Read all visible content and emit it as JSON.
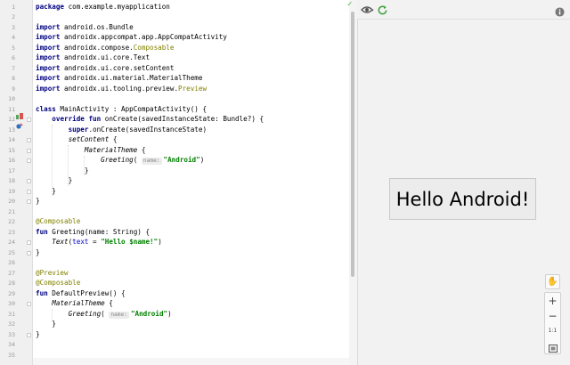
{
  "editor": {
    "lines": [
      {
        "n": "1",
        "t": [
          {
            "c": "kw",
            "v": "package"
          },
          {
            "v": " com.example.myapplication"
          }
        ]
      },
      {
        "n": "2",
        "t": []
      },
      {
        "n": "3",
        "t": [
          {
            "c": "kw",
            "v": "import"
          },
          {
            "v": " android.os.Bundle"
          }
        ]
      },
      {
        "n": "4",
        "t": [
          {
            "c": "kw",
            "v": "import"
          },
          {
            "v": " androidx.appcompat.app.AppCompatActivity"
          }
        ]
      },
      {
        "n": "5",
        "t": [
          {
            "c": "kw",
            "v": "import"
          },
          {
            "v": " androidx.compose."
          },
          {
            "c": "ann",
            "v": "Composable"
          }
        ]
      },
      {
        "n": "6",
        "t": [
          {
            "c": "kw",
            "v": "import"
          },
          {
            "v": " androidx.ui.core.Text"
          }
        ]
      },
      {
        "n": "7",
        "t": [
          {
            "c": "kw",
            "v": "import"
          },
          {
            "v": " androidx.ui.core.setContent"
          }
        ]
      },
      {
        "n": "8",
        "t": [
          {
            "c": "kw",
            "v": "import"
          },
          {
            "v": " androidx.ui.material.MaterialTheme"
          }
        ]
      },
      {
        "n": "9",
        "t": [
          {
            "c": "kw",
            "v": "import"
          },
          {
            "v": " androidx.ui.tooling.preview."
          },
          {
            "c": "ann",
            "v": "Preview"
          }
        ]
      },
      {
        "n": "10",
        "t": []
      },
      {
        "n": "11",
        "t": [
          {
            "c": "kw",
            "v": "class"
          },
          {
            "v": " MainActivity : AppCompatActivity() {"
          }
        ]
      },
      {
        "n": "12",
        "t": [
          {
            "v": "    "
          },
          {
            "c": "kw",
            "v": "override fun"
          },
          {
            "v": " onCreate(savedInstanceState: Bundle?) {"
          }
        ]
      },
      {
        "n": "13",
        "t": [
          {
            "v": "        "
          },
          {
            "c": "kw",
            "v": "super"
          },
          {
            "v": ".onCreate(savedInstanceState)"
          }
        ]
      },
      {
        "n": "14",
        "t": [
          {
            "v": "        "
          },
          {
            "c": "it",
            "v": "setContent"
          },
          {
            "v": " {"
          }
        ]
      },
      {
        "n": "15",
        "t": [
          {
            "v": "            "
          },
          {
            "c": "it",
            "v": "MaterialTheme"
          },
          {
            "v": " {"
          }
        ]
      },
      {
        "n": "16",
        "t": [
          {
            "v": "                "
          },
          {
            "c": "it",
            "v": "Greeting"
          },
          {
            "v": "( "
          },
          {
            "c": "hint",
            "v": "name:"
          },
          {
            "c": "str",
            "v": "\"Android\""
          },
          {
            "v": ")"
          }
        ]
      },
      {
        "n": "17",
        "t": [
          {
            "v": "            }"
          }
        ]
      },
      {
        "n": "18",
        "t": [
          {
            "v": "        }"
          }
        ]
      },
      {
        "n": "19",
        "t": [
          {
            "v": "    }"
          }
        ]
      },
      {
        "n": "20",
        "t": [
          {
            "v": "}"
          }
        ]
      },
      {
        "n": "21",
        "t": []
      },
      {
        "n": "22",
        "t": [
          {
            "c": "ann",
            "v": "@Composable"
          }
        ]
      },
      {
        "n": "23",
        "t": [
          {
            "c": "kw",
            "v": "fun"
          },
          {
            "v": " Greeting(name: String) {"
          }
        ]
      },
      {
        "n": "24",
        "t": [
          {
            "v": "    "
          },
          {
            "c": "it",
            "v": "Text"
          },
          {
            "v": "("
          },
          {
            "c": "prm",
            "v": "text"
          },
          {
            "v": " = "
          },
          {
            "c": "str",
            "v": "\"Hello $name!\""
          },
          {
            "v": ")"
          }
        ]
      },
      {
        "n": "25",
        "t": [
          {
            "v": "}"
          }
        ]
      },
      {
        "n": "26",
        "t": []
      },
      {
        "n": "27",
        "t": [
          {
            "c": "ann",
            "v": "@Preview"
          }
        ]
      },
      {
        "n": "28",
        "t": [
          {
            "c": "ann",
            "v": "@Composable"
          }
        ]
      },
      {
        "n": "29",
        "t": [
          {
            "c": "kw",
            "v": "fun"
          },
          {
            "v": " DefaultPreview() {"
          }
        ]
      },
      {
        "n": "30",
        "t": [
          {
            "v": "    "
          },
          {
            "c": "it",
            "v": "MaterialTheme"
          },
          {
            "v": " {"
          }
        ]
      },
      {
        "n": "31",
        "t": [
          {
            "v": "        "
          },
          {
            "c": "it",
            "v": "Greeting"
          },
          {
            "v": "( "
          },
          {
            "c": "hint",
            "v": "name:"
          },
          {
            "c": "str",
            "v": "\"Android\""
          },
          {
            "v": ")"
          }
        ]
      },
      {
        "n": "32",
        "t": [
          {
            "v": "    }"
          }
        ]
      },
      {
        "n": "33",
        "t": [
          {
            "v": "}"
          }
        ]
      },
      {
        "n": "34",
        "t": []
      },
      {
        "n": "35",
        "t": []
      }
    ]
  },
  "preview": {
    "hello_text": "Hello Android!",
    "zoom": {
      "in": "+",
      "out": "−",
      "actual": "1:1"
    }
  },
  "icons": {
    "status": "check-icon",
    "eye": "eye-icon",
    "refresh": "refresh-icon",
    "info": "info-icon",
    "hand": "hand-icon",
    "fit": "fit-screen-icon"
  },
  "colors": {
    "keyword": "#000080",
    "annotation": "#808000",
    "string": "#008000",
    "ok": "#4caf50"
  }
}
